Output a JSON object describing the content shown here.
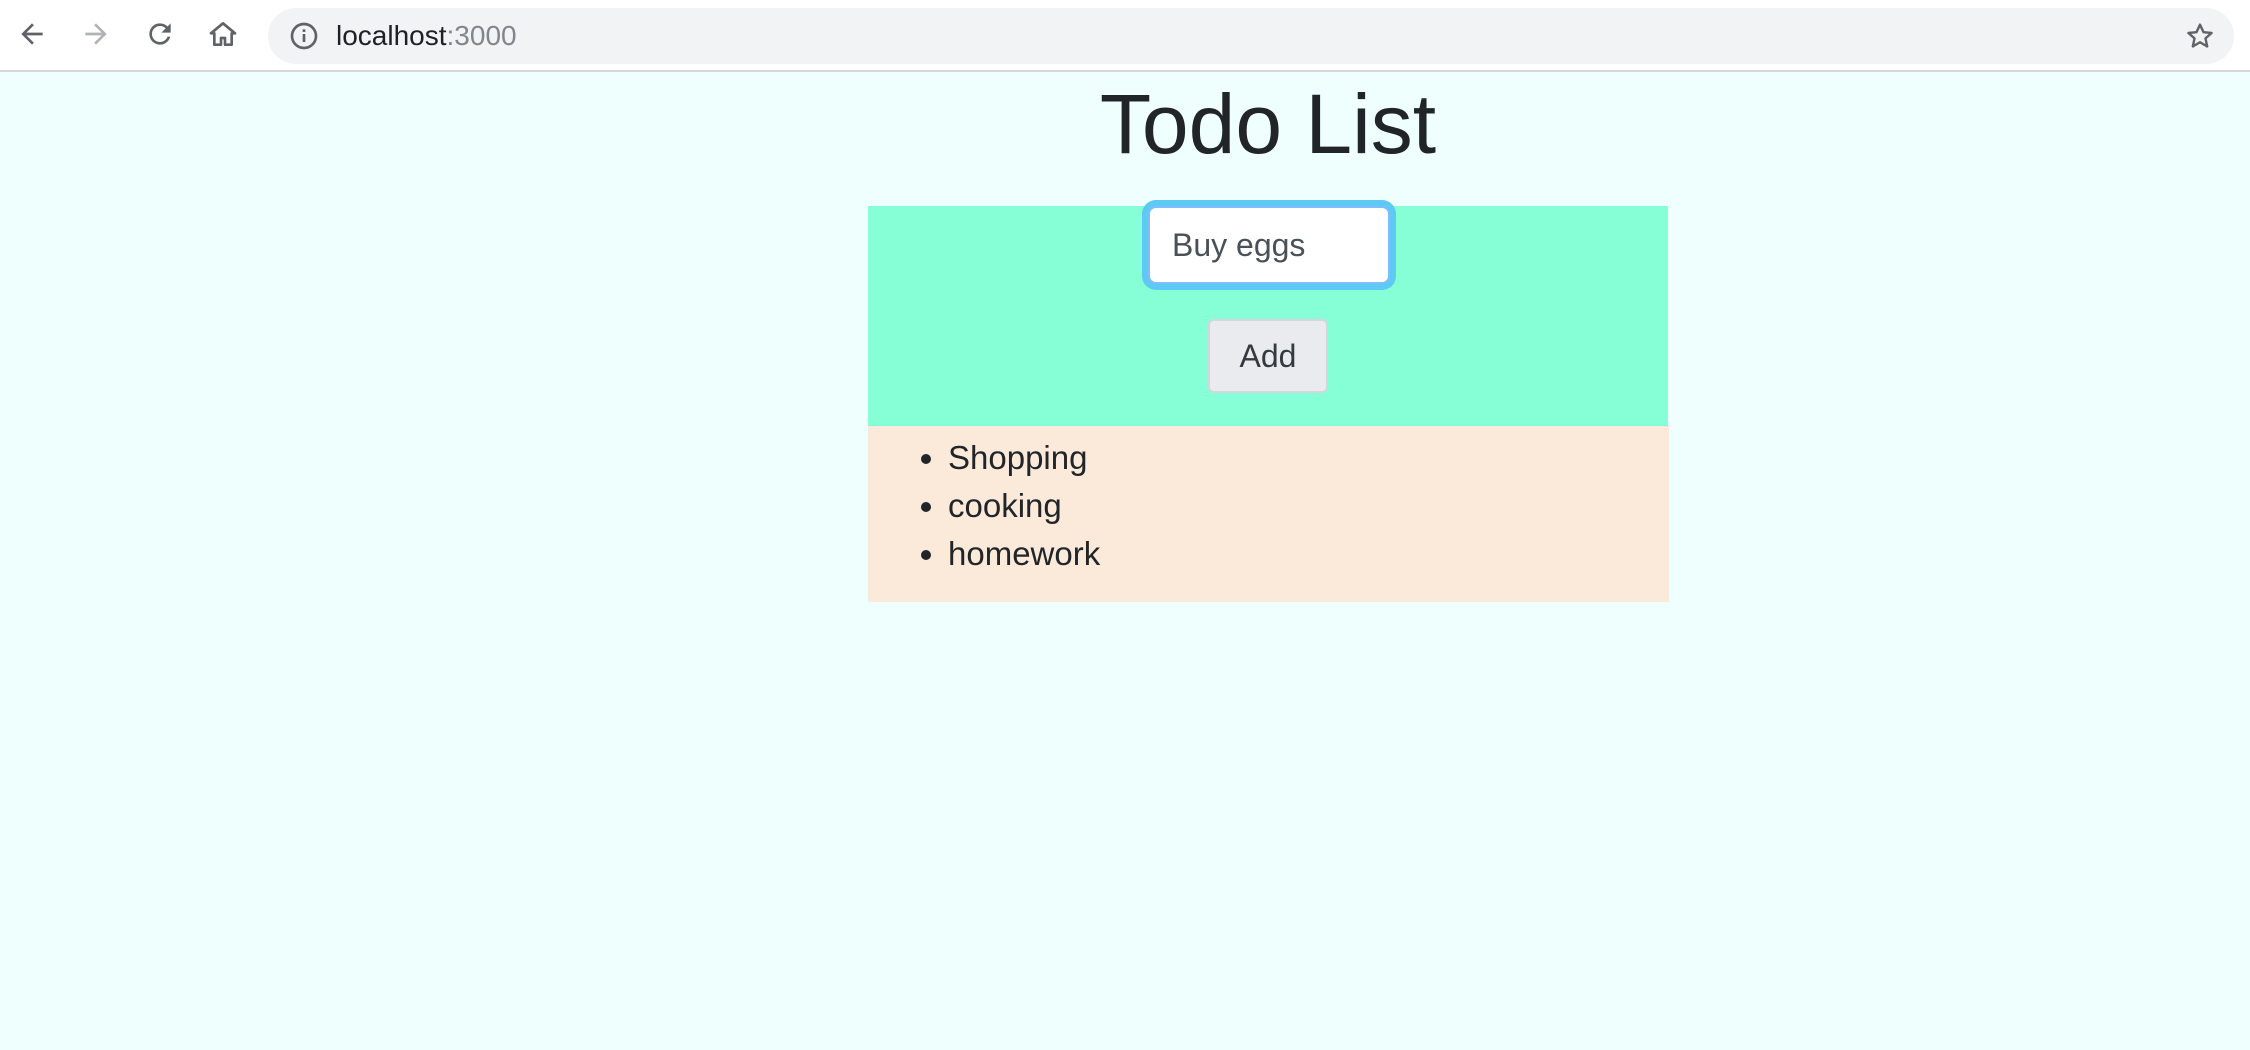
{
  "browser": {
    "url_host": "localhost",
    "url_port": ":3000",
    "icons": [
      "back-arrow-icon",
      "forward-arrow-icon",
      "reload-icon",
      "home-icon",
      "info-icon",
      "star-icon"
    ]
  },
  "page": {
    "title": "Todo List",
    "input_value": "Buy eggs",
    "add_label": "Add",
    "todos": [
      "Shopping",
      "cooking",
      "homework"
    ]
  },
  "colors": {
    "page_background": "#effffe",
    "form_background": "#86ffd7",
    "list_background": "#fbeada",
    "input_focus_ring": "#7ee3ee"
  }
}
